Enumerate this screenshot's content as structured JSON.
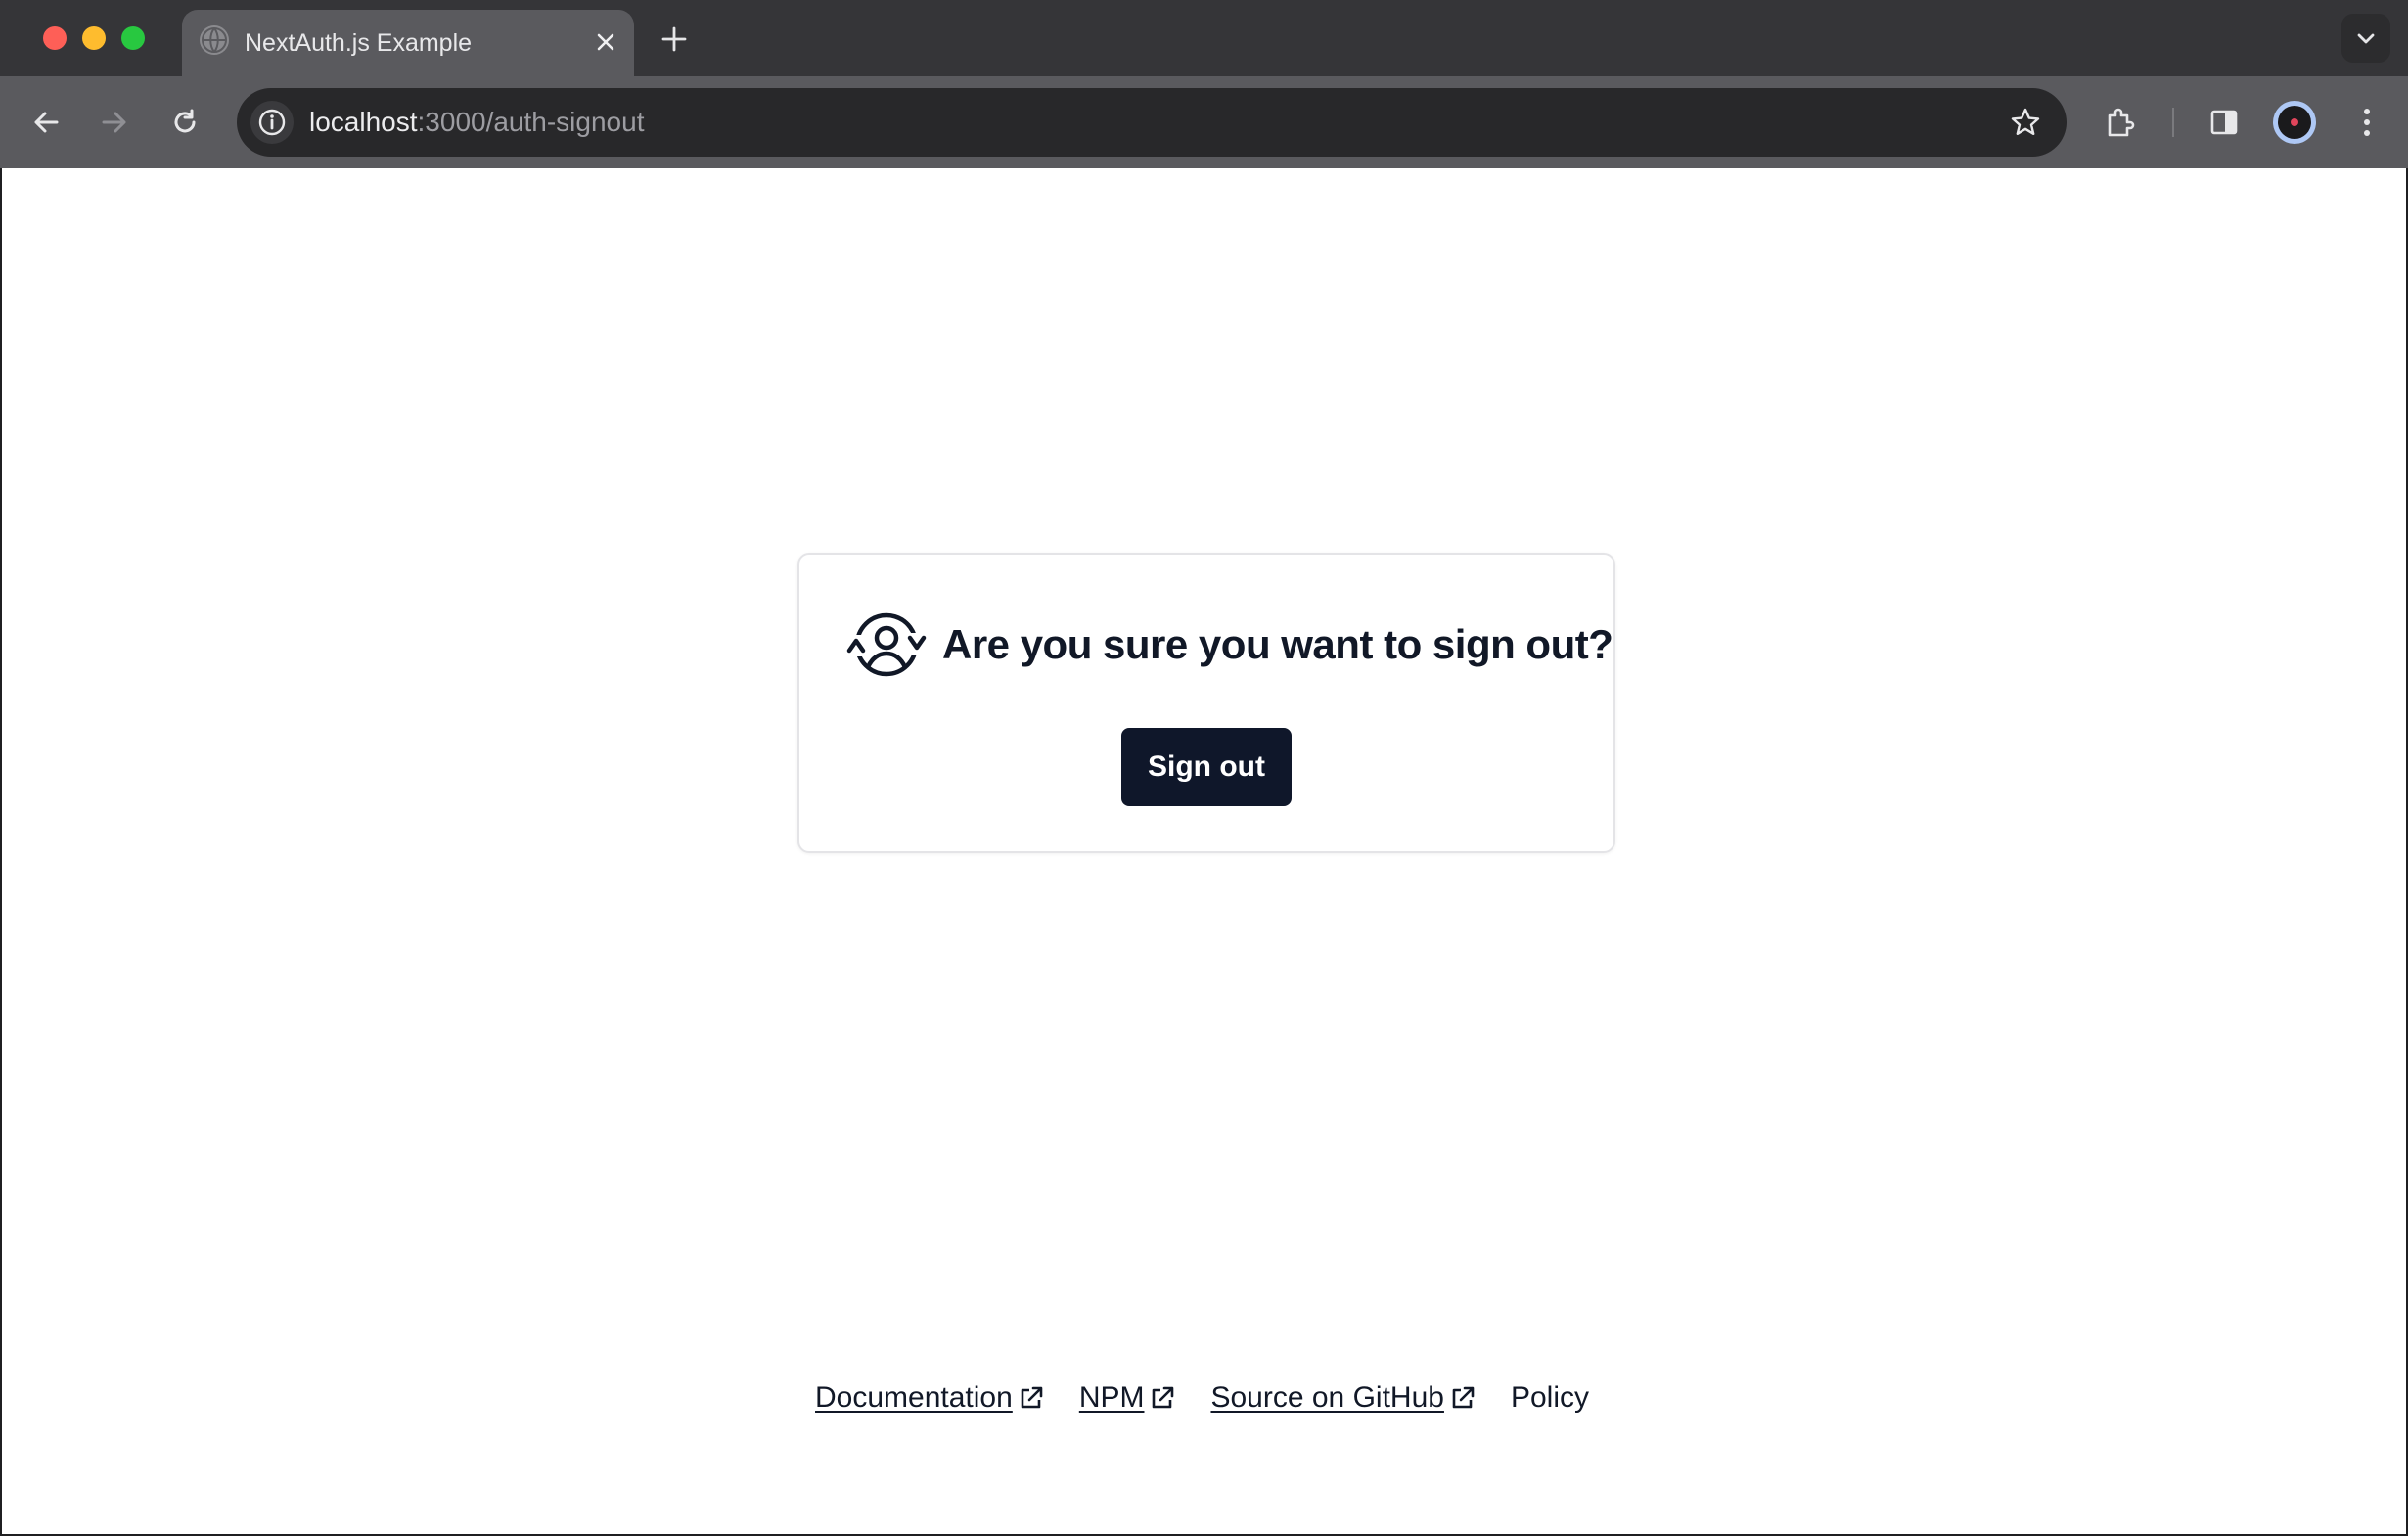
{
  "browser": {
    "tab": {
      "title": "NextAuth.js Example"
    },
    "url": {
      "host": "localhost",
      "path": ":3000/auth-signout"
    }
  },
  "page": {
    "card": {
      "title": "Are you sure you want to sign out?",
      "button_label": "Sign out"
    },
    "footer": {
      "links": [
        {
          "label": "Documentation",
          "external": true
        },
        {
          "label": "NPM",
          "external": true
        },
        {
          "label": "Source on GitHub",
          "external": true
        },
        {
          "label": "Policy",
          "external": false
        }
      ]
    }
  },
  "colors": {
    "button_bg": "#0f172a",
    "text": "#111827",
    "chrome_dark": "#353538",
    "chrome_toolbar": "#5a5a5e"
  }
}
